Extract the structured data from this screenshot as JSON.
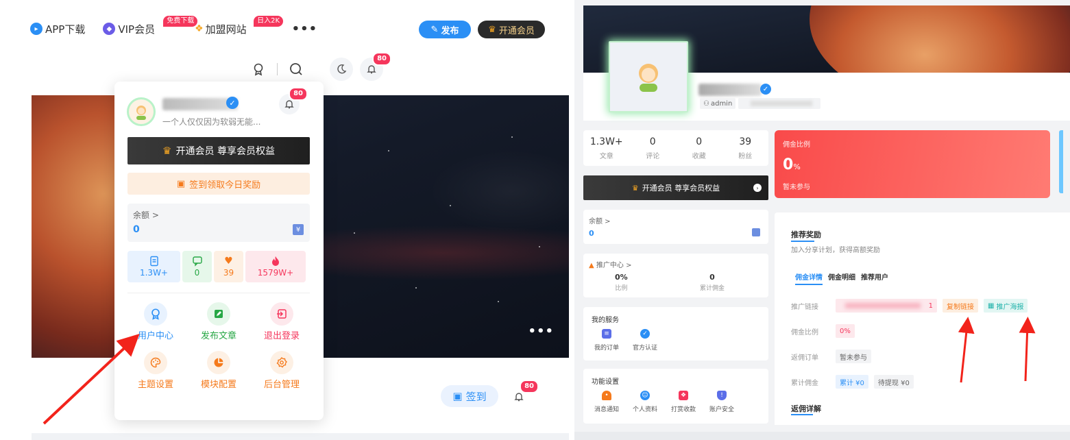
{
  "left": {
    "topnav": {
      "app_download": "APP下载",
      "vip_member": "VIP会员",
      "vip_badge": "免费下载",
      "join_site": "加盟网站",
      "join_badge": "日入2K",
      "more": "•••"
    },
    "publish_button": "发布",
    "open_vip_button": "开通会员",
    "notification_count": "80",
    "banner_more": "•••",
    "sign_button": "签到",
    "bottom_notification_count": "80",
    "popup": {
      "description": "一个人仅仅因为软弱无能...",
      "notification_count": "80",
      "vip_banner": "开通会员 尊享会员权益",
      "checkin_banner": "签到领取今日奖励",
      "balance_label": "余额 >",
      "balance_value": "0",
      "stats": [
        {
          "value": "1.3W+",
          "color": "#2b8ff5",
          "bg": "#e8f2fe"
        },
        {
          "value": "0",
          "color": "#27a745",
          "bg": "#e6f7ea"
        },
        {
          "value": "39",
          "color": "#f57a1c",
          "bg": "#fdf0e4"
        },
        {
          "value": "1579W+",
          "color": "#f5365c",
          "bg": "#fde8ec"
        }
      ],
      "grid": [
        {
          "label": "用户中心",
          "color": "#2b8ff5",
          "bg": "#e8f2fe",
          "icon": "medal-icon"
        },
        {
          "label": "发布文章",
          "color": "#27a745",
          "bg": "#e6f7ea",
          "icon": "edit-icon"
        },
        {
          "label": "退出登录",
          "color": "#f5365c",
          "bg": "#fde8ec",
          "icon": "logout-icon"
        },
        {
          "label": "主题设置",
          "color": "#f57a1c",
          "bg": "#fdf0e4",
          "icon": "palette-icon"
        },
        {
          "label": "模块配置",
          "color": "#f57a1c",
          "bg": "#fdf0e4",
          "icon": "module-icon"
        },
        {
          "label": "后台管理",
          "color": "#f57a1c",
          "bg": "#fdf0e4",
          "icon": "gear-icon"
        }
      ]
    }
  },
  "right": {
    "admin_tag": "admin",
    "stats": [
      {
        "value": "1.3W+",
        "label": "文章"
      },
      {
        "value": "0",
        "label": "评论"
      },
      {
        "value": "0",
        "label": "收藏"
      },
      {
        "value": "39",
        "label": "粉丝"
      }
    ],
    "vip_banner": "开通会员 尊享会员权益",
    "commission_card": {
      "title": "佣金比例",
      "value": "0",
      "unit": "%",
      "status": "暂未参与"
    },
    "balance_label": "余额 >",
    "balance_value": "0",
    "promo": {
      "title": "推广中心 >",
      "ratio_value": "0%",
      "ratio_label": "比例",
      "total_value": "0",
      "total_label": "累计佣金"
    },
    "services": {
      "title": "我的服务",
      "items": [
        {
          "label": "我的订单",
          "color": "#5b6ee8"
        },
        {
          "label": "官方认证",
          "color": "#2b8ff5"
        }
      ]
    },
    "settings": {
      "title": "功能设置",
      "items": [
        {
          "label": "消息通知",
          "color": "#f57a1c"
        },
        {
          "label": "个人资料",
          "color": "#2b8ff5"
        },
        {
          "label": "打赏收款",
          "color": "#f5365c"
        },
        {
          "label": "账户安全",
          "color": "#5b6ee8"
        }
      ]
    },
    "main": {
      "title": "推荐奖励",
      "subtitle": "加入分享计划，获得高额奖励",
      "tabs": [
        "佣金详情",
        "佣金明细",
        "推荐用户"
      ],
      "rows": {
        "link_label": "推广链接",
        "link_suffix": "1",
        "copy_button": "复制链接",
        "poster_button": "推广海报",
        "ratio_label": "佣金比例",
        "ratio_value": "0%",
        "orders_label": "返佣订单",
        "orders_value": "暂未参与",
        "total_label": "累计佣金",
        "total_value": "累计 ¥0",
        "pending_value": "待提现 ¥0"
      },
      "detail_title": "返佣详解"
    }
  }
}
